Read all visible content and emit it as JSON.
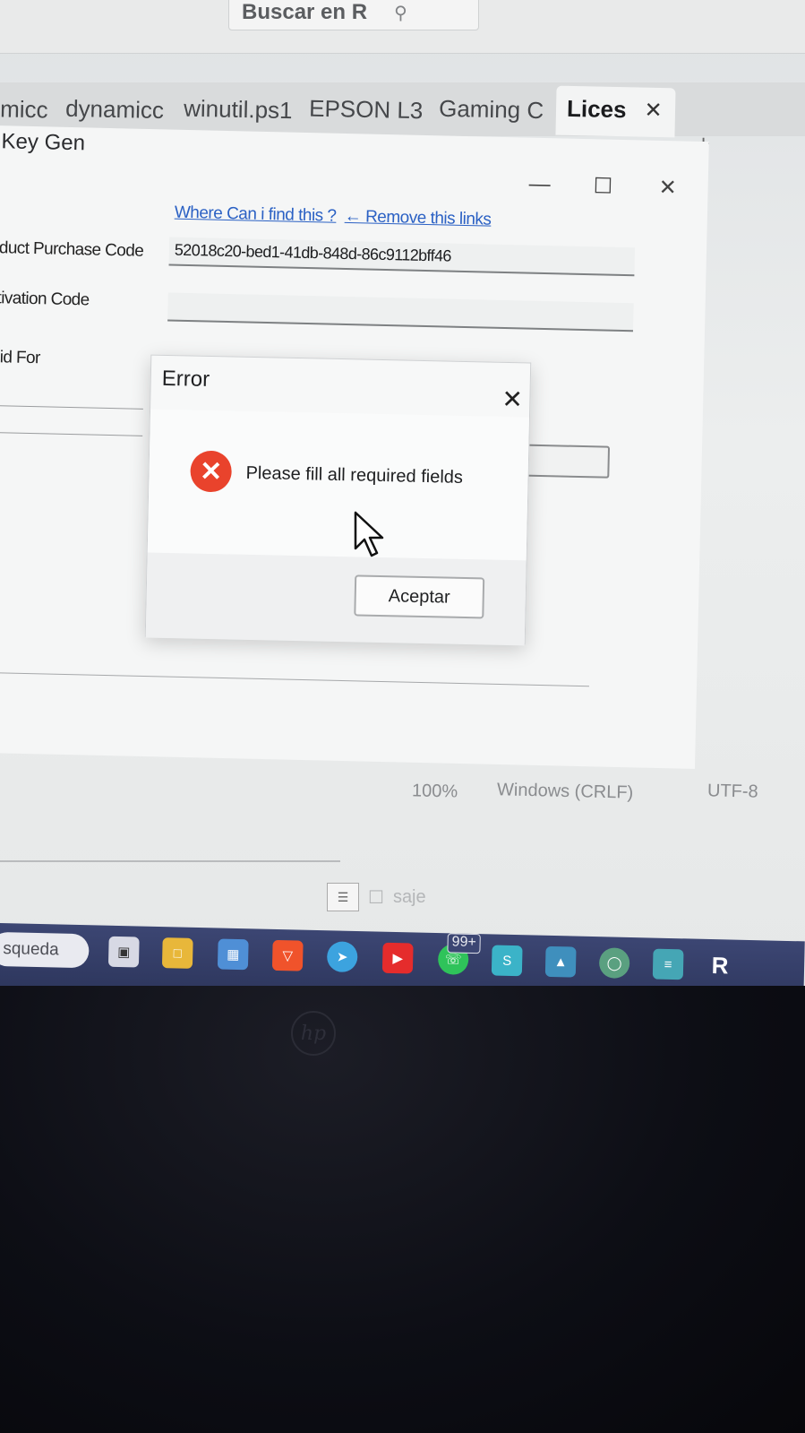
{
  "search": {
    "text": "Buscar en R",
    "icon": "search-icon"
  },
  "tabs": [
    {
      "label": "micc"
    },
    {
      "label": "dynamicc"
    },
    {
      "label": "winutil.ps1"
    },
    {
      "label": "EPSON L3"
    },
    {
      "label": "Gaming C"
    },
    {
      "label": "Lices",
      "active": true
    }
  ],
  "keygen": {
    "title": "Key Gen",
    "link_where": "Where Can i find this ?",
    "link_remove": "← Remove this links",
    "labels": {
      "purchase_code": "oduct Purchase Code",
      "activation_code": "ctivation Code",
      "valid_for": "alid For"
    },
    "purchase_code_value": "52018c20-bed1-41db-848d-86c9112bff46",
    "activation_code_value": ""
  },
  "dialog": {
    "title": "Error",
    "message": "Please fill all required fields",
    "ok_label": "Aceptar"
  },
  "status_bar": {
    "zoom": "100%",
    "line_ending": "Windows (CRLF)",
    "encoding": "UTF-8"
  },
  "widget": {
    "label": "saje"
  },
  "taskbar": {
    "search_label": "squeda",
    "badge": "99+"
  },
  "colors": {
    "error_red": "#e9432c",
    "link_blue": "#2b61c4",
    "taskbar": "#3c4673"
  }
}
